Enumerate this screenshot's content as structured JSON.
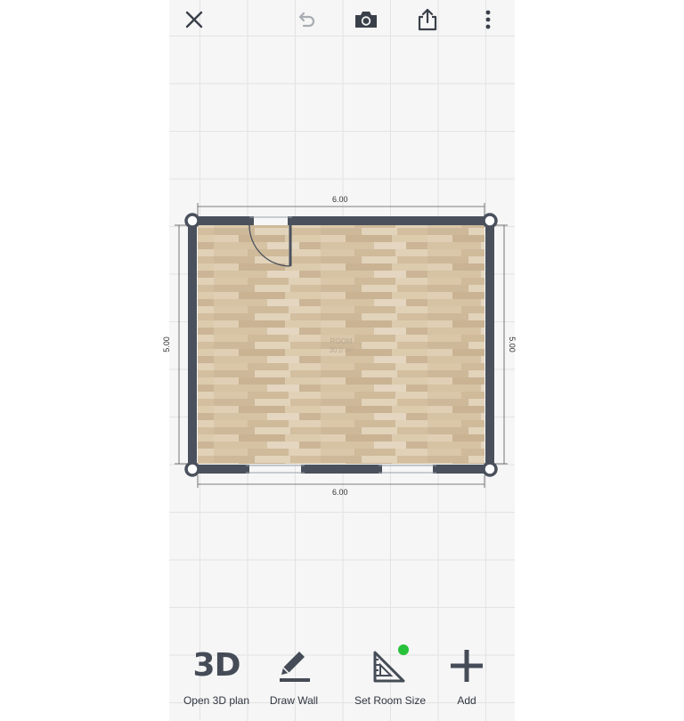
{
  "topbar": {
    "close": {
      "icon": "close-icon"
    },
    "undo": {
      "icon": "undo-icon"
    },
    "camera": {
      "icon": "camera-icon"
    },
    "share": {
      "icon": "share-icon"
    },
    "more": {
      "icon": "more-vertical-icon"
    }
  },
  "plan": {
    "top_dimension": "6.00",
    "bottom_dimension": "6.00",
    "left_dimension": "5.00",
    "right_dimension": "5.00",
    "room_name": "ROOM",
    "room_area": "30.0 m²"
  },
  "toolbar": {
    "open3d": {
      "icon_text": "3D",
      "label": "Open 3D plan"
    },
    "draw_wall": {
      "label": "Draw Wall",
      "icon": "pencil-icon"
    },
    "set_room_size": {
      "label": "Set Room Size",
      "icon": "ruler-triangle-icon",
      "badge_color": "#27c23a"
    },
    "add": {
      "label": "Add",
      "icon": "plus-icon"
    }
  },
  "colors": {
    "wall": "#4a515c",
    "floor": "#d9c6a8",
    "icon": "#3a4049"
  }
}
